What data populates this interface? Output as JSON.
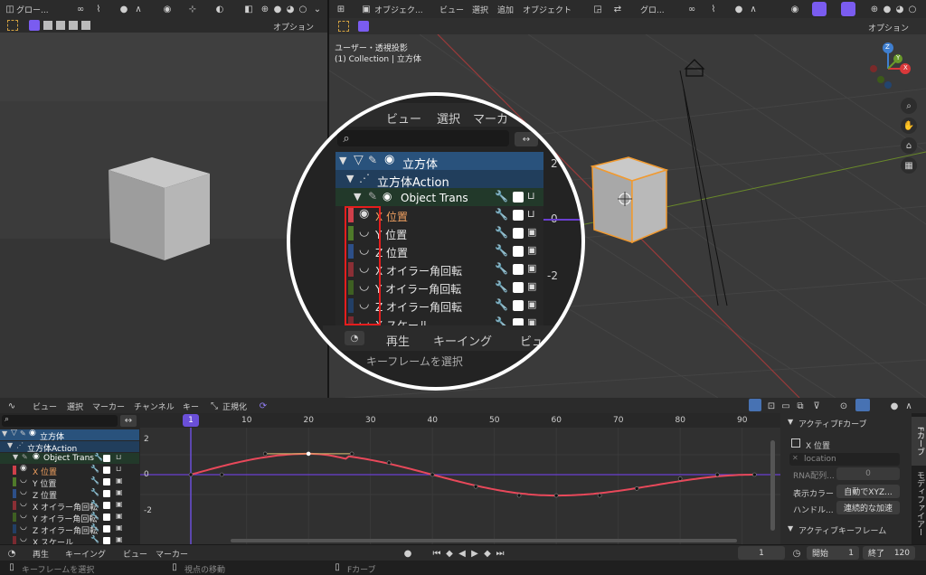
{
  "left_view": {
    "header_items": [
      "グロー..."
    ],
    "options_label": "オプション"
  },
  "viewport": {
    "header_items": [
      "オブジェク...",
      "ビュー",
      "選択",
      "追加",
      "オブジェクト",
      "グロ..."
    ],
    "options_label": "オプション",
    "overlay_line1": "ユーザー・透視投影",
    "overlay_line2": "(1) Collection | 立方体",
    "nav_axes": {
      "x": "X",
      "y": "Y",
      "z": "Z"
    }
  },
  "magnifier": {
    "menu": [
      "ビュー",
      "選択",
      "マーカ"
    ],
    "tree": {
      "object": "立方体",
      "action": "立方体Action",
      "group": "Object Trans",
      "channels": [
        "X 位置",
        "Y 位置",
        "Z 位置",
        "X オイラー角回転",
        "Y オイラー角回転",
        "Z オイラー角回転",
        "X スケール"
      ]
    },
    "bottom": {
      "play": "再生",
      "keying": "キーイング",
      "view": "ビュ"
    },
    "status": "キーフレームを選択",
    "axis_labels": [
      "2",
      "0",
      "-2"
    ]
  },
  "graph_editor": {
    "menu": [
      "ビュー",
      "選択",
      "マーカー",
      "チャンネル",
      "キー"
    ],
    "normalize": "正規化",
    "tree": {
      "object": "立方体",
      "action": "立方体Action",
      "group": "Object Trans",
      "channels": [
        "X 位置",
        "Y 位置",
        "Z 位置",
        "X オイラー角回転",
        "Y オイラー角回転",
        "Z オイラー角回転",
        "X スケール"
      ]
    },
    "frame_ticks": [
      "10",
      "20",
      "30",
      "40",
      "50",
      "60",
      "70",
      "80",
      "90"
    ],
    "current_frame": "1",
    "value_ticks": [
      "2",
      "0",
      "-2"
    ]
  },
  "sidebar": {
    "section_fcurve": "アクティブFカーブ",
    "channel_name": "X 位置",
    "path_placeholder": "location",
    "rna_label": "RNA配列...",
    "rna_value": "0",
    "display_color_label": "表示カラー",
    "display_color_value": "自動でXYZ...",
    "handle_label": "ハンドル...",
    "handle_value": "連続的な加速",
    "section_keyframe": "アクティブキーフレーム",
    "tabs": [
      "Fカーブ",
      "モディファイアー",
      "ビ"
    ]
  },
  "timeline": {
    "play": "再生",
    "keying": "キーイング",
    "view": "ビュー",
    "marker": "マーカー",
    "current_frame": "1",
    "start_label": "開始",
    "start_value": "1",
    "end_label": "終了",
    "end_value": "120"
  },
  "statusbar": {
    "select": "キーフレームを選択",
    "move": "視点の移動",
    "fcurve": "Fカーブ"
  },
  "colors": {
    "accent": "#4772b3",
    "purple": "#7a5cf0",
    "red_axis": "#d9383a",
    "green_axis": "#6a9a2a",
    "curve": "#e8485a",
    "highlight_box": "#e51d1d"
  }
}
